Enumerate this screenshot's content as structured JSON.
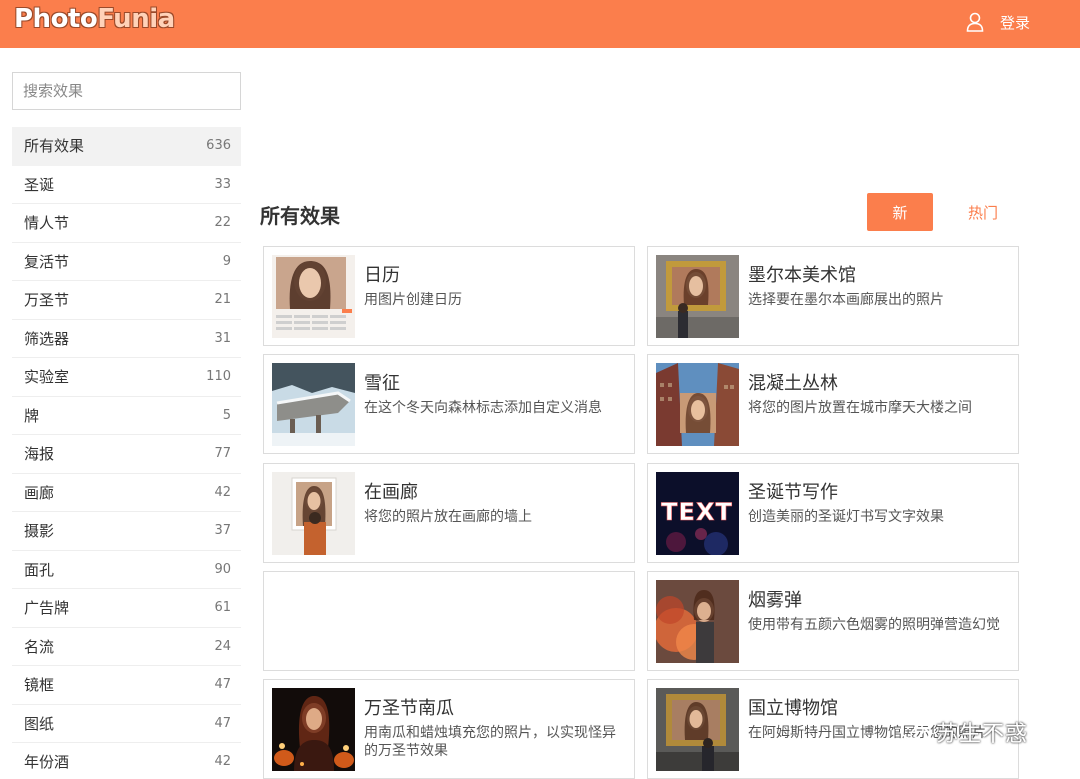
{
  "header": {
    "logo_photo": "Photo",
    "logo_funia": "Funia",
    "login_label": "登录"
  },
  "search": {
    "placeholder": "搜索效果"
  },
  "categories": [
    {
      "label": "所有效果",
      "count": "636"
    },
    {
      "label": "圣诞",
      "count": "33"
    },
    {
      "label": "情人节",
      "count": "22"
    },
    {
      "label": "复活节",
      "count": "9"
    },
    {
      "label": "万圣节",
      "count": "21"
    },
    {
      "label": "筛选器",
      "count": "31"
    },
    {
      "label": "实验室",
      "count": "110"
    },
    {
      "label": "牌",
      "count": "5"
    },
    {
      "label": "海报",
      "count": "77"
    },
    {
      "label": "画廊",
      "count": "42"
    },
    {
      "label": "摄影",
      "count": "37"
    },
    {
      "label": "面孔",
      "count": "90"
    },
    {
      "label": "广告牌",
      "count": "61"
    },
    {
      "label": "名流",
      "count": "24"
    },
    {
      "label": "镜框",
      "count": "47"
    },
    {
      "label": "图纸",
      "count": "47"
    },
    {
      "label": "年份酒",
      "count": "42"
    }
  ],
  "main": {
    "section_title": "所有效果",
    "sort_new": "新",
    "sort_hot": "热门"
  },
  "effects": [
    {
      "title": "日历",
      "desc": "用图片创建日历",
      "thumb": "calendar-thumbnail"
    },
    {
      "title": "墨尔本美术馆",
      "desc": "选择要在墨尔本画廊展出的照片",
      "thumb": "gallery-frame-thumbnail"
    },
    {
      "title": "雪征",
      "desc": "在这个冬天向森林标志添加自定义消息",
      "thumb": "snow-sign-thumbnail"
    },
    {
      "title": "混凝土丛林",
      "desc": "将您的图片放置在城市摩天大楼之间",
      "thumb": "skyscraper-thumbnail"
    },
    {
      "title": "在画廊",
      "desc": "将您的照片放在画廊的墙上",
      "thumb": "gallery-wall-thumbnail"
    },
    {
      "title": "圣诞节写作",
      "desc": "创造美丽的圣诞灯书写文字效果",
      "thumb": "christmas-lights-thumbnail"
    },
    {
      "title": "",
      "desc": "",
      "thumb": ""
    },
    {
      "title": "烟雾弹",
      "desc": "使用带有五颜六色烟雾的照明弹营造幻觉",
      "thumb": "smoke-bomb-thumbnail"
    },
    {
      "title": "万圣节南瓜",
      "desc": "用南瓜和蜡烛填充您的照片，以实现怪异的万圣节效果",
      "thumb": "pumpkin-thumbnail"
    },
    {
      "title": "国立博物馆",
      "desc": "在阿姆斯特丹国立博物馆展示您的照片",
      "thumb": "museum-thumbnail"
    }
  ],
  "thumb_texts": {
    "christmas_lights": "TEXT"
  },
  "watermark": {
    "text": "苏生不惑"
  },
  "colors": {
    "brand": "#fb7e4c",
    "active_bg": "#f2f2f2",
    "border": "#dcdcdc"
  }
}
